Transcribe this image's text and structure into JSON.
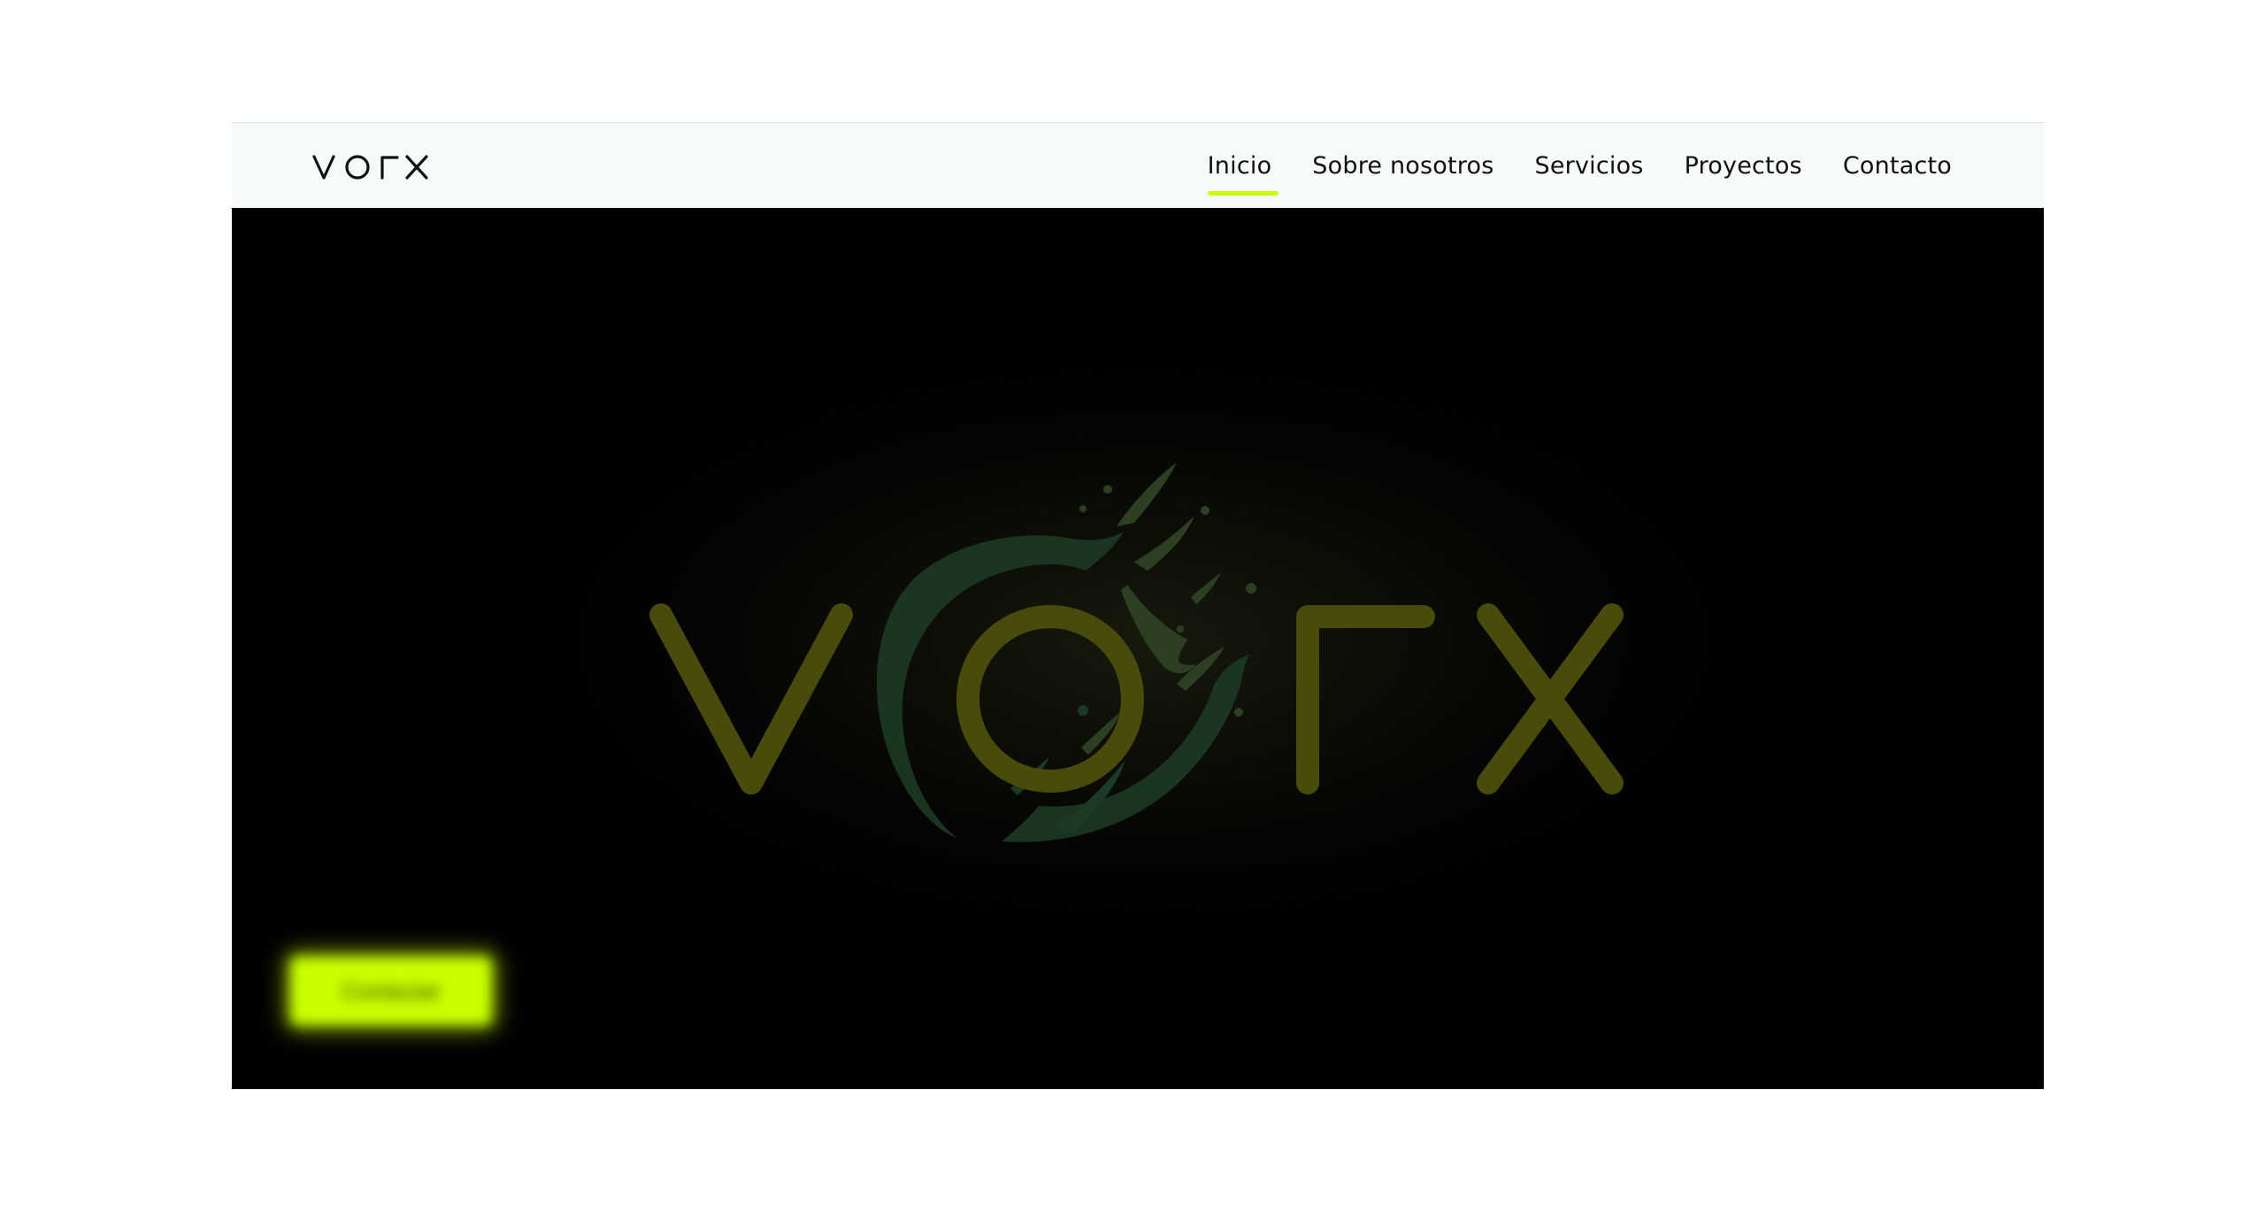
{
  "brand": {
    "name": "vorx",
    "logo_color": "#111111"
  },
  "nav": {
    "items": [
      {
        "label": "Inicio",
        "active": true
      },
      {
        "label": "Sobre nosotros",
        "active": false
      },
      {
        "label": "Servicios",
        "active": false
      },
      {
        "label": "Proyectos",
        "active": false
      },
      {
        "label": "Contacto",
        "active": false
      }
    ],
    "active_underline_color": "#c8ff00"
  },
  "hero": {
    "logo_text": "vorx",
    "background_color": "#000000",
    "logo_letter_color": "#4a4a0c",
    "splash_color": "#233a1e",
    "cta_label": "Contactar",
    "cta_color": "#c8ff00"
  }
}
